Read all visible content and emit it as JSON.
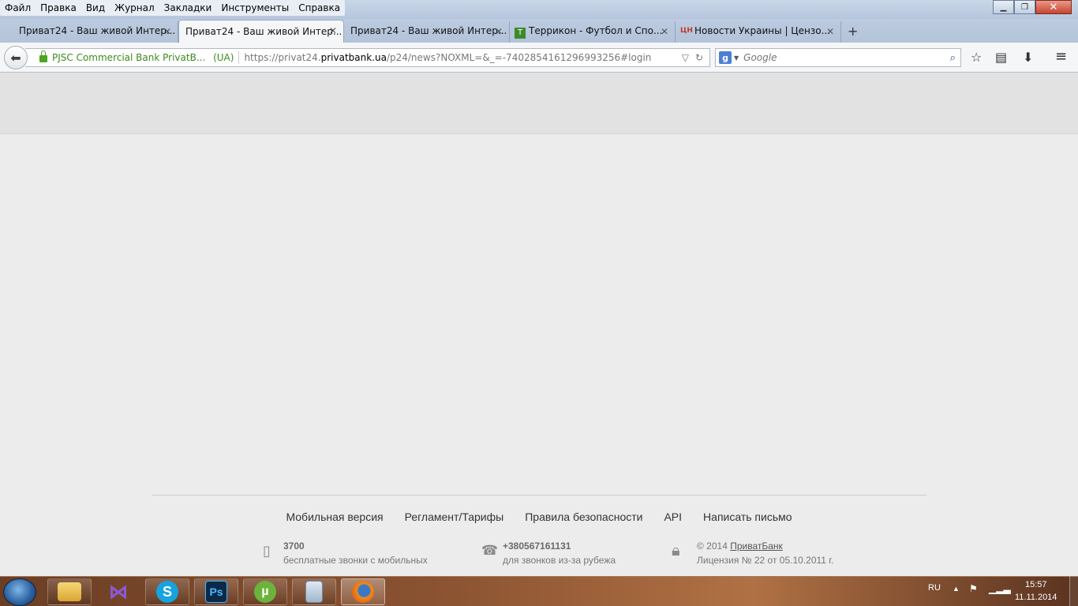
{
  "browser": {
    "menu": [
      "Файл",
      "Правка",
      "Вид",
      "Журнал",
      "Закладки",
      "Инструменты",
      "Справка"
    ],
    "tabs": [
      {
        "label": "Приват24 - Ваш живой Интер...",
        "active": false
      },
      {
        "label": "Приват24 - Ваш живой Интер...",
        "active": true
      },
      {
        "label": "Приват24 - Ваш живой Интер...",
        "active": false
      },
      {
        "label": "Террикон - Футбол и Спо...",
        "active": false,
        "icon": "terrikon-icon"
      },
      {
        "label": "Новости Украины | Цензо...",
        "active": false,
        "icon_text": "ЦН"
      }
    ],
    "identity": "PJSC Commercial Bank PrivatB...",
    "identity_country": "(UA)",
    "url_prefix": "https://privat24.",
    "url_host": "privatbank.ua",
    "url_rest": "/p24/news?NOXML=&_=-7402854161296993256#login",
    "search_placeholder": "Google",
    "search_engine_letter": "g"
  },
  "footer": {
    "links": [
      "Мобильная версия",
      "Регламент/Тарифы",
      "Правила безопасности",
      "API",
      "Написать письмо"
    ],
    "phone_short": "3700",
    "phone_short_desc": "бесплатные звонки с мобильных",
    "phone_intl": "+380567161131",
    "phone_intl_desc": "для звонков из-за рубежа",
    "copyright_prefix": "© 2014",
    "copyright_link": "ПриватБанк",
    "license": "Лицензия № 22 от 05.10.2011 г."
  },
  "taskbar": {
    "apps": [
      "explorer",
      "visual-studio",
      "skype",
      "photoshop",
      "utorrent",
      "calculator",
      "firefox"
    ],
    "ps_label": "Ps",
    "skype_label": "S",
    "lang": "RU",
    "time": "15:57",
    "date": "11.11.2014"
  }
}
